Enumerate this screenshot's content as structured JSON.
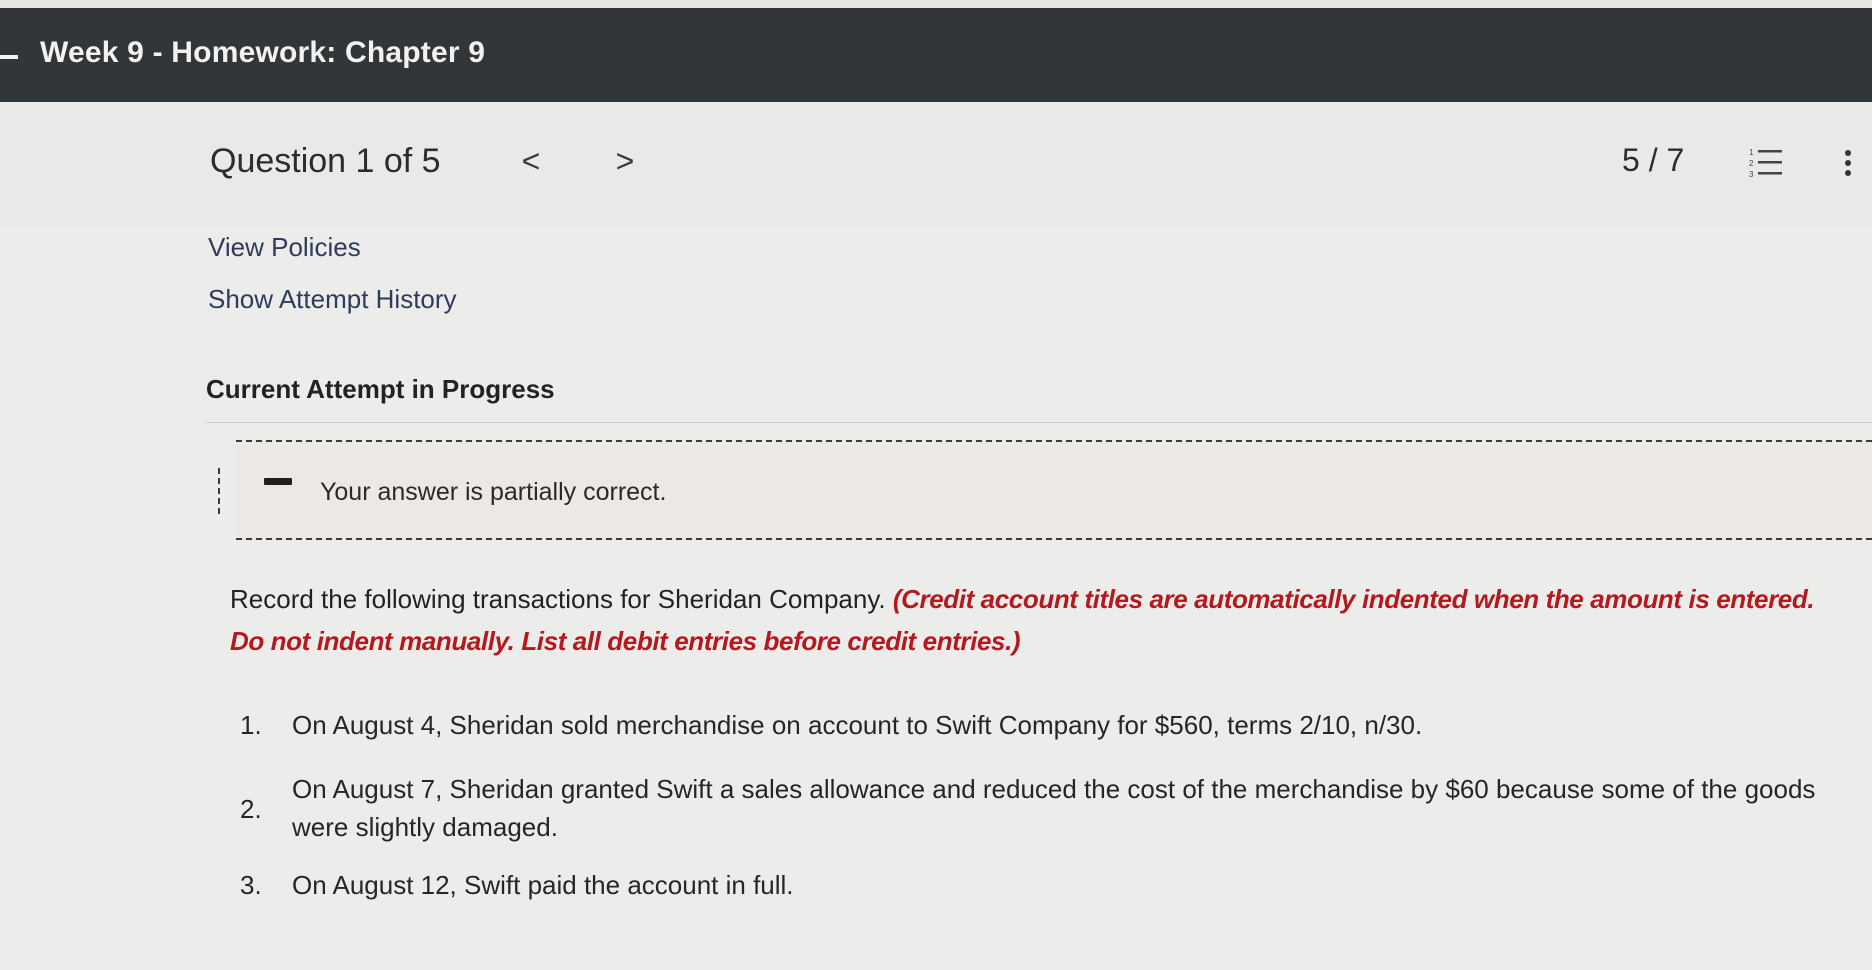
{
  "header": {
    "title": "Week 9 - Homework: Chapter 9"
  },
  "question_bar": {
    "label": "Question 1 of 5",
    "prev": "<",
    "next": ">",
    "score": "5 / 7"
  },
  "links": {
    "view_policies": "View Policies",
    "show_history": "Show Attempt History"
  },
  "attempt": {
    "heading": "Current Attempt in Progress"
  },
  "feedback": {
    "text": "Your answer is partially correct."
  },
  "instructions": {
    "lead": "Record the following transactions for Sheridan Company. ",
    "note": "(Credit account titles are automatically indented when the amount is entered. Do not indent manually. List all debit entries before credit entries.)"
  },
  "transactions": [
    {
      "num": "1.",
      "text": "On August 4, Sheridan sold merchandise on account to Swift Company for $560, terms 2/10, n/30."
    },
    {
      "num": "2.",
      "text": "On August 7, Sheridan granted Swift a sales allowance and reduced the cost of the merchandise by $60 because some of the goods were slightly damaged."
    },
    {
      "num": "3.",
      "text": "On August 12, Swift paid the account in full."
    }
  ],
  "colors": {
    "titlebar": "#333638",
    "instruction_note": "#b3191e"
  }
}
